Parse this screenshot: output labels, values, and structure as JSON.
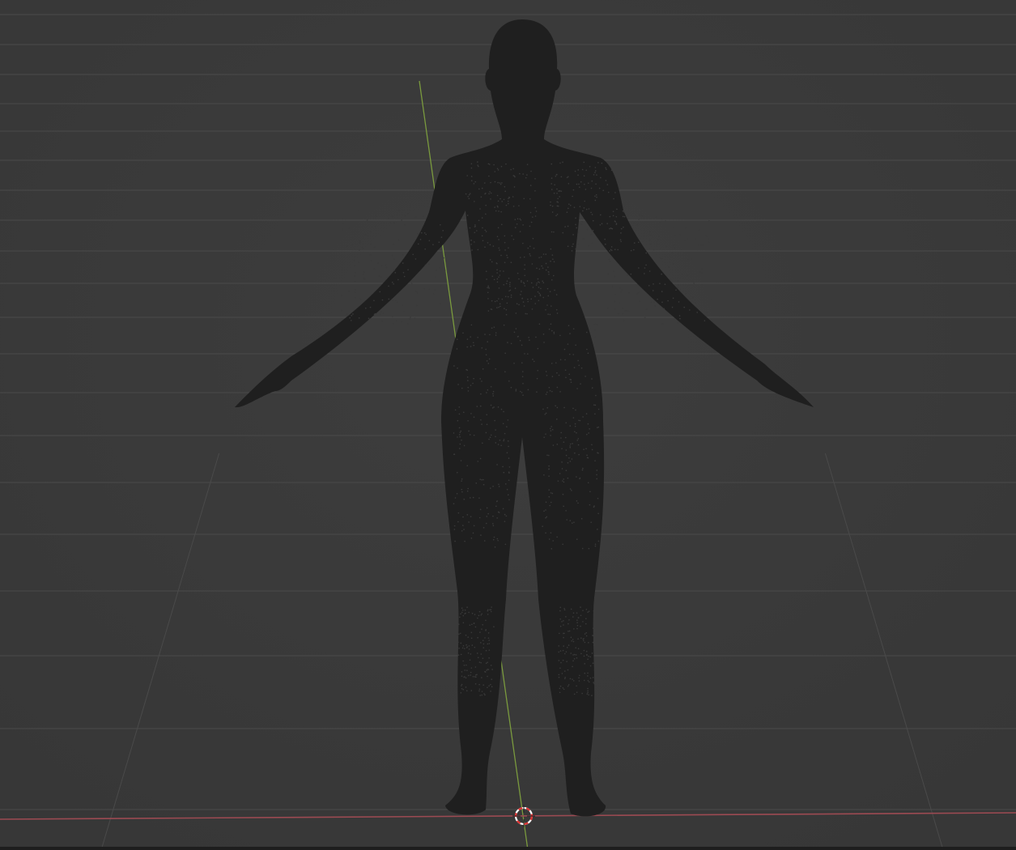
{
  "viewport": {
    "background_color": "#3b3b3b",
    "grid_color": "#4a4a4a",
    "x_axis_color": "#9c4a52",
    "y_axis_color": "#7a9a3e",
    "mesh_color": "#1f1f1f",
    "cursor_colors": [
      "#e03030",
      "#ffffff"
    ]
  }
}
